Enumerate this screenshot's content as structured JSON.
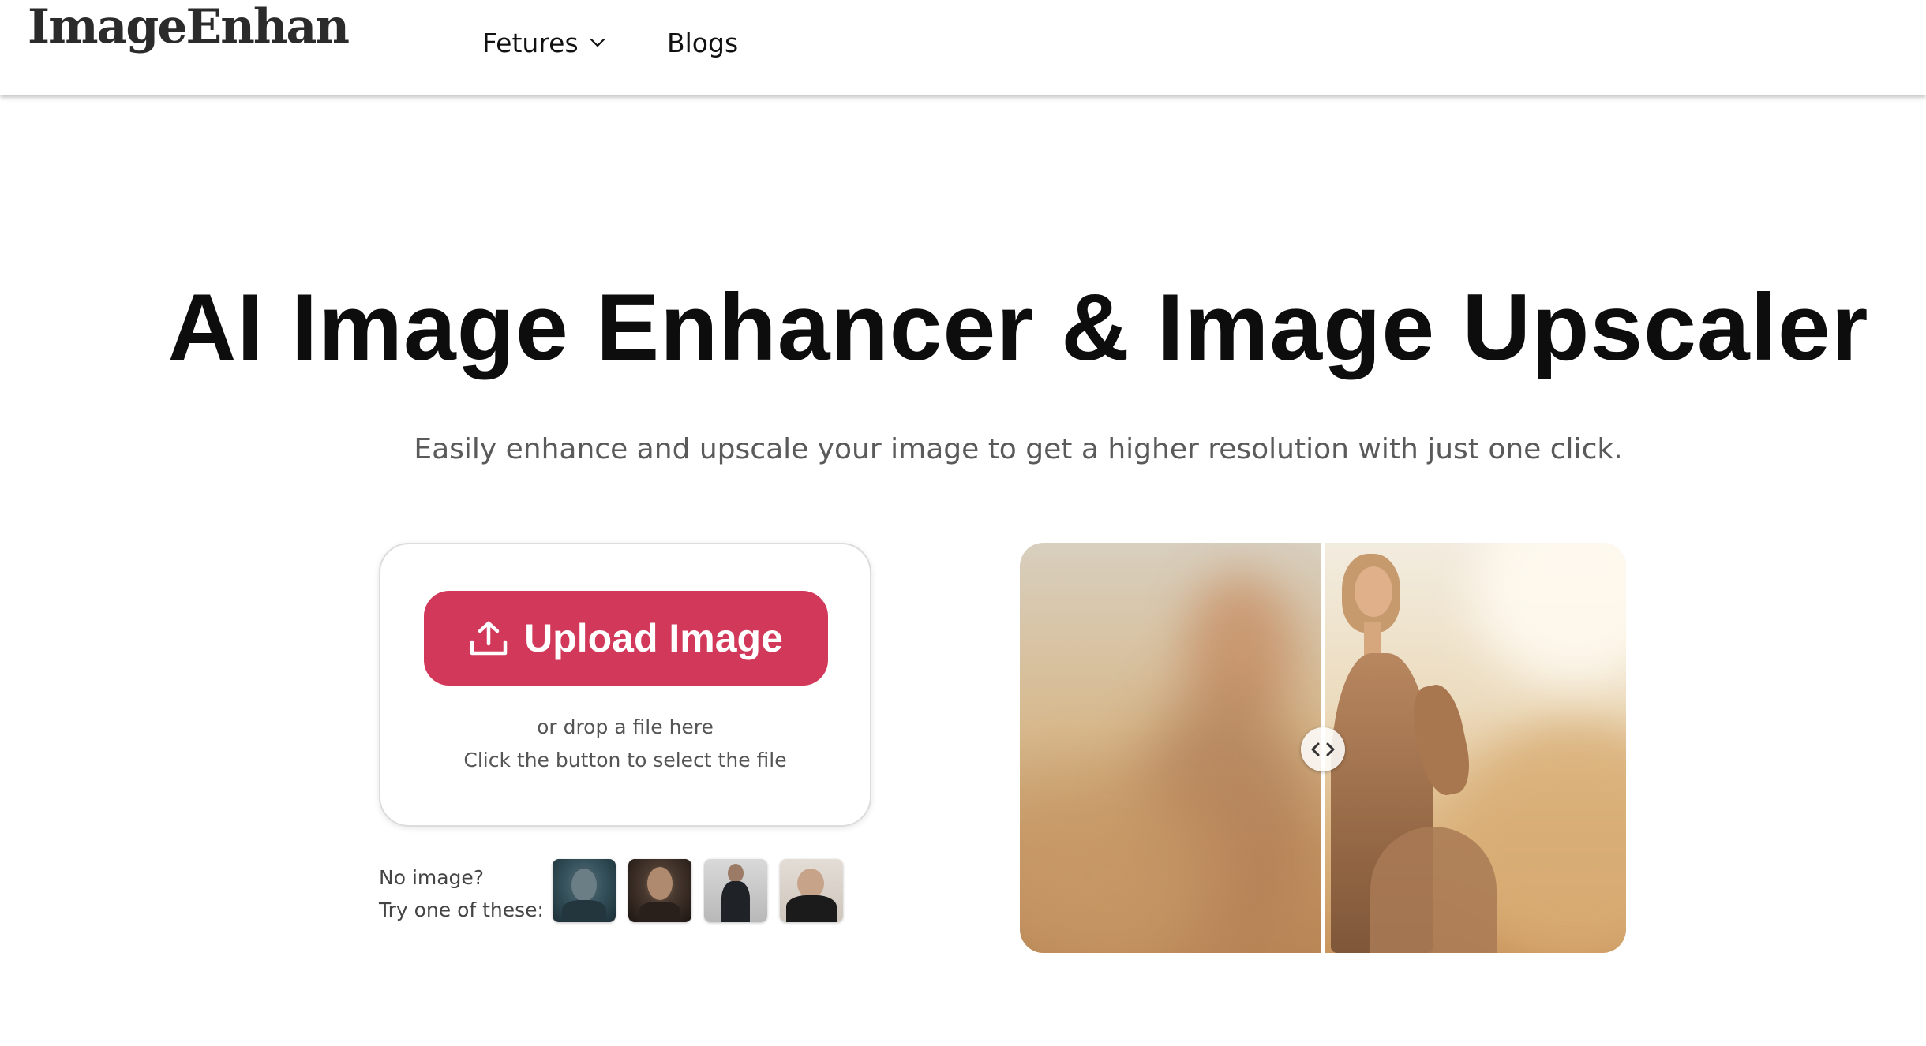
{
  "header": {
    "logo": "ImageEnhan",
    "nav": {
      "features_label": "Fetures",
      "blogs_label": "Blogs"
    }
  },
  "hero": {
    "title": "AI Image Enhancer & Image Upscaler",
    "subtitle": "Easily enhance and upscale your image to get a higher resolution with just one click."
  },
  "upload": {
    "button_label": "Upload Image",
    "drop_text": "or drop a file here",
    "hint_text": "Click the button to select the file"
  },
  "samples": {
    "label_line1": "No image?",
    "label_line2": "Try one of these:",
    "count": 4
  },
  "colors": {
    "accent": "#d1385a",
    "text": "#0d0d0d",
    "muted": "#5a5a5a"
  },
  "icons": [
    "chevron-down-icon",
    "upload-icon",
    "compare-arrows-icon"
  ]
}
